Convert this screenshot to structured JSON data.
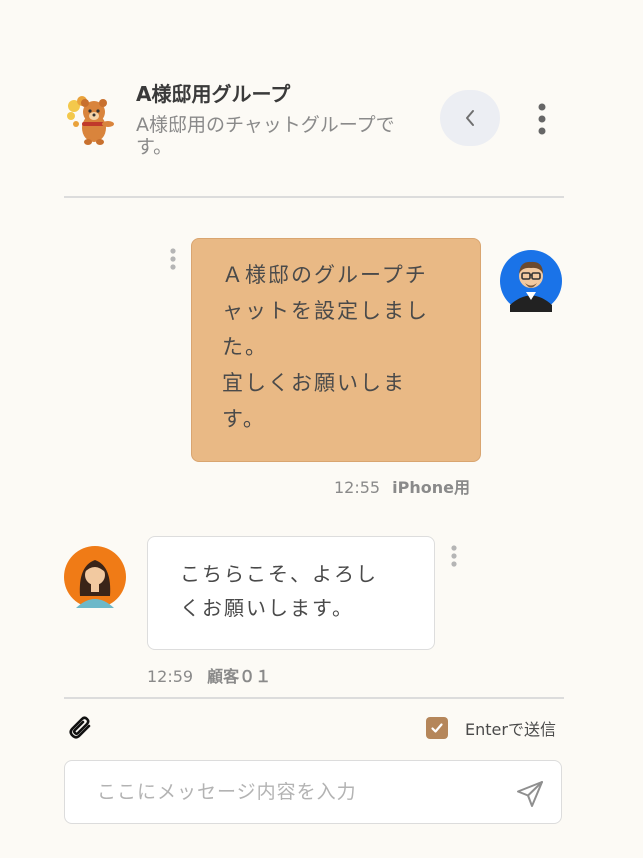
{
  "header": {
    "title": "A様邸用グループ",
    "description": "A様邸用のチャットグループです。",
    "avatar_icon": "cartoon-bear-icon",
    "back_icon": "chevron-left-icon",
    "menu_icon": "vertical-dots-icon"
  },
  "messages": [
    {
      "direction": "outgoing",
      "lines": [
        "Ａ様邸のグループチ",
        "ャットを設定しまし",
        "た。",
        "宜しくお願いしま",
        "す。"
      ],
      "time": "12:55",
      "sender": "iPhone用",
      "avatar_icon": "man-with-glasses-avatar-icon",
      "bubble_color": "#e9b985"
    },
    {
      "direction": "incoming",
      "lines": [
        "こちらこそ、よろし",
        "くお願いします。"
      ],
      "time": "12:59",
      "sender": "顧客０１",
      "avatar_icon": "woman-avatar-icon",
      "bubble_color": "#ffffff"
    }
  ],
  "composer": {
    "attach_icon": "paperclip-icon",
    "enter_to_send_label": "Enterで送信",
    "enter_to_send_checked": true,
    "placeholder": "ここにメッセージ内容を入力",
    "value": "",
    "send_icon": "send-icon",
    "accent_color": "#b5865a"
  }
}
